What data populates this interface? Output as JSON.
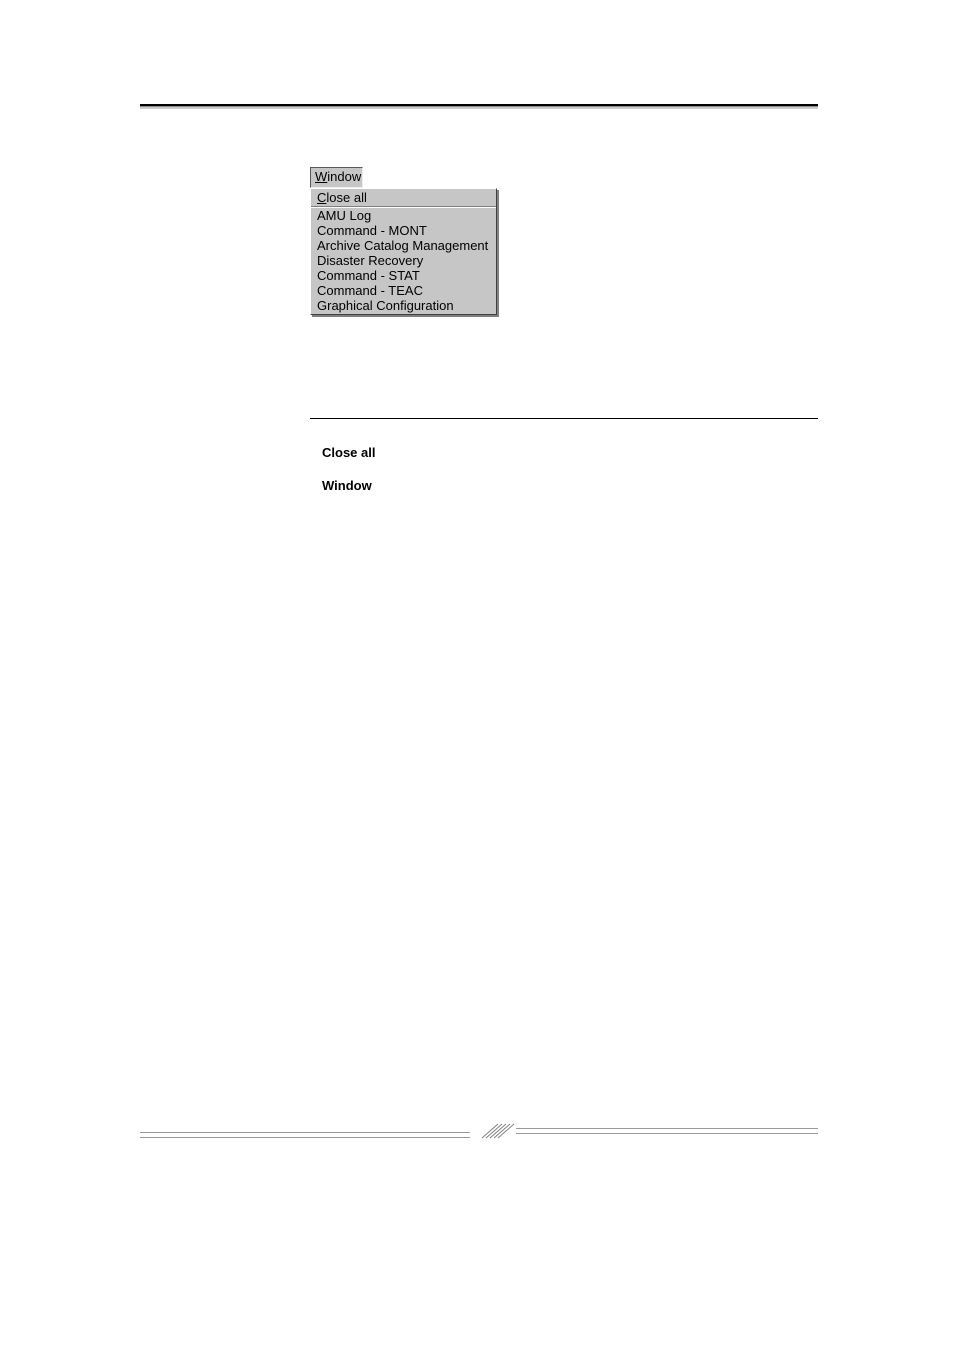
{
  "menu": {
    "title_prefix": "W",
    "title_rest": "indow",
    "items": [
      {
        "mn": "C",
        "rest": "lose all",
        "sep": true
      },
      {
        "mn": "",
        "rest": "AMU Log"
      },
      {
        "mn": "",
        "rest": "Command - MONT"
      },
      {
        "mn": "",
        "rest": "Archive Catalog Management"
      },
      {
        "mn": "",
        "rest": "Disaster Recovery"
      },
      {
        "mn": "",
        "rest": "Command - STAT"
      },
      {
        "mn": "",
        "rest": "Command - TEAC"
      },
      {
        "mn": "",
        "rest": "Graphical Configuration"
      }
    ]
  },
  "labels": {
    "close_all": "Close all",
    "window": "Window"
  }
}
